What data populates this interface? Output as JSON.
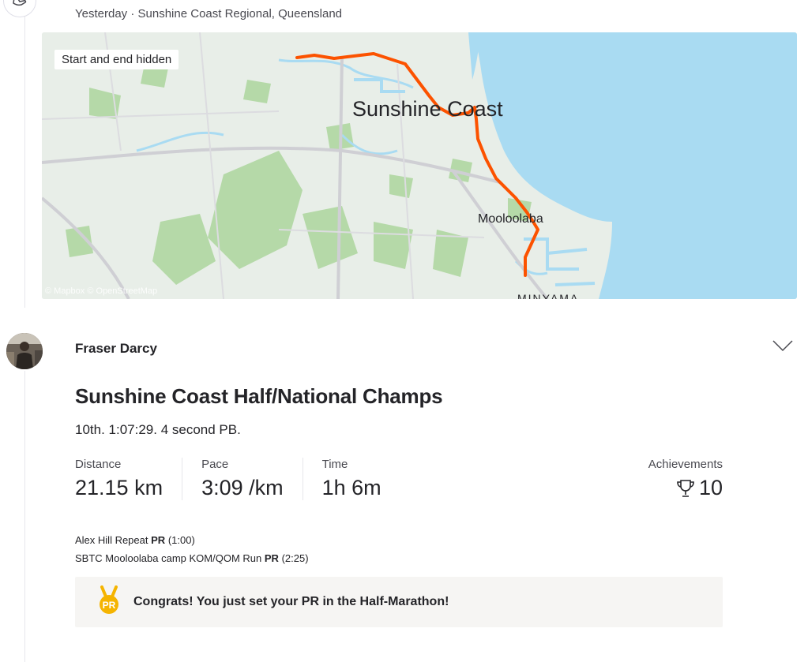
{
  "activity_meta": {
    "date": "Yesterday",
    "separator": "·",
    "location": "Sunshine Coast Regional, Queensland"
  },
  "map": {
    "privacy_badge": "Start and end hidden",
    "attribution": "© Mapbox © OpenStreetMap",
    "labels": {
      "city": "Sunshine Coast",
      "suburb_1": "Mooloolaba",
      "suburb_2": "MINYAMA"
    },
    "route_color": "#fc5200",
    "water_color": "#a9dbf2",
    "land_color": "#e8eee8"
  },
  "athlete": {
    "name": "Fraser Darcy",
    "menu_icon": "chevron-down-icon"
  },
  "activity": {
    "title": "Sunshine Coast Half/National Champs",
    "description": "10th. 1:07:29. 4 second PB."
  },
  "stats": [
    {
      "label": "Distance",
      "value": "21.15 km"
    },
    {
      "label": "Pace",
      "value": "3:09 /km"
    },
    {
      "label": "Time",
      "value": "1h 6m"
    }
  ],
  "achievements": {
    "label": "Achievements",
    "icon": "trophy-icon",
    "count": "10"
  },
  "segments": [
    {
      "name": "Alex Hill Repeat",
      "badge": "PR",
      "time": "(1:00)"
    },
    {
      "name": "SBTC Mooloolaba camp KOM/QOM Run",
      "badge": "PR",
      "time": "(2:25)"
    }
  ],
  "pr_banner": {
    "icon": "pr-medal-icon",
    "medal_text": "PR",
    "message": "Congrats! You just set your PR in the Half-Marathon!"
  }
}
